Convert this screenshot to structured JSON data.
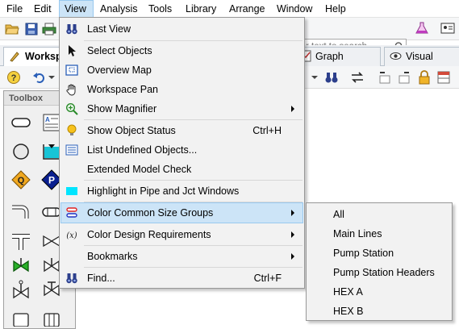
{
  "menubar": {
    "items": [
      "File",
      "Edit",
      "View",
      "Analysis",
      "Tools",
      "Library",
      "Arrange",
      "Window",
      "Help"
    ],
    "open_item": "View"
  },
  "search": {
    "placeholder": "r text to search..."
  },
  "tabs": [
    {
      "label": "Worksp",
      "icon": "workspace-icon",
      "active": true
    },
    {
      "label": "Graph Results",
      "icon": "graph-icon",
      "active": false
    },
    {
      "label": "Visual Repor",
      "icon": "eye-icon",
      "active": false
    }
  ],
  "toolbox": {
    "title": "Toolbox"
  },
  "view_menu": {
    "items": [
      {
        "label": "Last View",
        "icon": "binoculars-icon"
      },
      {
        "label": "Select Objects",
        "icon": "arrow-cursor-icon"
      },
      {
        "label": "Overview Map",
        "icon": "overview-map-icon"
      },
      {
        "label": "Workspace Pan",
        "icon": "hand-icon"
      },
      {
        "label": "Show Magnifier",
        "icon": "magnifier-icon",
        "submenu": true
      },
      {
        "label": "Show Object Status",
        "icon": "lightbulb-icon",
        "shortcut": "Ctrl+H"
      },
      {
        "label": "List Undefined Objects...",
        "icon": "list-icon"
      },
      {
        "label": "Extended Model Check",
        "icon": ""
      },
      {
        "label": "Highlight in Pipe and Jct Windows",
        "icon": "highlight-swatch-icon"
      },
      {
        "label": "Color Common Size Groups",
        "icon": "size-groups-icon",
        "submenu": true,
        "highlighted": true
      },
      {
        "label": "Color Design Requirements",
        "icon": "design-requirements-icon",
        "submenu": true
      },
      {
        "label": "Bookmarks",
        "icon": "",
        "submenu": true
      },
      {
        "label": "Find...",
        "icon": "binoculars-icon",
        "shortcut": "Ctrl+F"
      }
    ]
  },
  "size_groups_submenu": {
    "items": [
      "All",
      "Main Lines",
      "Pump Station",
      "Pump Station Headers",
      "HEX A",
      "HEX B"
    ]
  },
  "colors": {
    "menu_highlight": "#cce4f7",
    "menu_highlight_border": "#99c9ef",
    "menu_bg": "#f2f2f2",
    "highlight_swatch": "#00e5ff",
    "pump_blue": "#0a1f8f"
  }
}
